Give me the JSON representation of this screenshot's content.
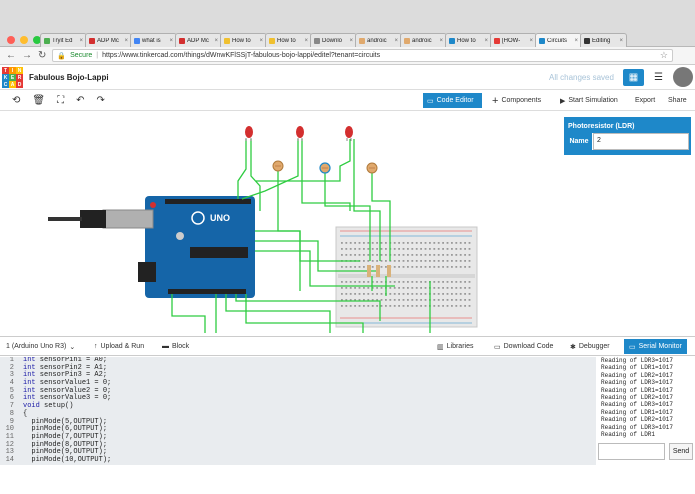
{
  "browser": {
    "tabs": [
      {
        "label": "Tryit Ed",
        "color": "#4caf50"
      },
      {
        "label": "ADP Mc",
        "color": "#d32f2f"
      },
      {
        "label": "what is",
        "color": "#4285f4"
      },
      {
        "label": "ADP Mc",
        "color": "#d32f2f"
      },
      {
        "label": "How to",
        "color": "#f0c02f"
      },
      {
        "label": "How to",
        "color": "#f0c02f"
      },
      {
        "label": "Downlo",
        "color": "#888888"
      },
      {
        "label": "androic",
        "color": "#e0a96d"
      },
      {
        "label": "androic",
        "color": "#e0a96d"
      },
      {
        "label": "How to",
        "color": "#1e88c9"
      },
      {
        "label": "[HOW-",
        "color": "#e53935"
      },
      {
        "label": "Circuits",
        "color": "#1e88c9",
        "active": true
      },
      {
        "label": "Editing",
        "color": "#333333"
      }
    ],
    "secure_label": "Secure",
    "url": "https://www.tinkercad.com/things/dWnwKFlSSjT-fabulous-bojo-lappi/editel?tenant=circuits"
  },
  "header": {
    "logo_letters": [
      "T",
      "I",
      "N",
      "K",
      "E",
      "R",
      "C",
      "A",
      "D"
    ],
    "logo_colors": [
      "#e53935",
      "#ff9800",
      "#ffc107",
      "#1e88c9",
      "#4caf50",
      "#e53935",
      "#1e88c9",
      "#ffc107",
      "#e53935"
    ],
    "project_name": "Fabulous Bojo-Lappi",
    "save_status": "All changes saved"
  },
  "toolbar": {
    "code_editor": "Code Editor",
    "components": "Components",
    "start_simulation": "Start Simulation",
    "export": "Export",
    "share": "Share"
  },
  "inspector": {
    "title": "Photoresistor (LDR)",
    "name_label": "Name",
    "name_value": "2"
  },
  "codebar": {
    "device": "1 (Arduino Uno R3)",
    "upload_run": "Upload & Run",
    "block": "Block",
    "libraries": "Libraries",
    "download_code": "Download Code",
    "debugger": "Debugger",
    "serial_monitor": "Serial Monitor"
  },
  "code": [
    {
      "n": "1",
      "pre": "",
      "kw": "int",
      "rest": " sensorPin1 = A0;"
    },
    {
      "n": "2",
      "pre": "",
      "kw": "int",
      "rest": " sensorPin2 = A1;"
    },
    {
      "n": "3",
      "pre": "",
      "kw": "int",
      "rest": " sensorPin3 = A2;"
    },
    {
      "n": "4",
      "pre": "",
      "kw": "int",
      "rest": " sensorValue1 = 0;"
    },
    {
      "n": "5",
      "pre": "",
      "kw": "int",
      "rest": " sensorValue2 = 0;"
    },
    {
      "n": "6",
      "pre": "",
      "kw": "int",
      "rest": " sensorValue3 = 0;"
    },
    {
      "n": "7",
      "pre": "",
      "kw": "void",
      "rest": " setup()"
    },
    {
      "n": "8",
      "pre": "{",
      "kw": "",
      "rest": ""
    },
    {
      "n": "9",
      "pre": "  pinMode(5,OUTPUT);",
      "kw": "",
      "rest": ""
    },
    {
      "n": "10",
      "pre": "  pinMode(6,OUTPUT);",
      "kw": "",
      "rest": ""
    },
    {
      "n": "11",
      "pre": "  pinMode(7,OUTPUT);",
      "kw": "",
      "rest": ""
    },
    {
      "n": "12",
      "pre": "  pinMode(8,OUTPUT);",
      "kw": "",
      "rest": ""
    },
    {
      "n": "13",
      "pre": "  pinMode(9,OUTPUT);",
      "kw": "",
      "rest": ""
    },
    {
      "n": "14",
      "pre": "  pinMode(10,OUTPUT);",
      "kw": "",
      "rest": ""
    }
  ],
  "serial": [
    "Reading of LDR3=1017",
    "Reading of LDR1=1017",
    "Reading of LDR2=1017",
    "Reading of LDR3=1017",
    "Reading of LDR1=1017",
    "Reading of LDR2=1017",
    "Reading of LDR3=1017",
    "Reading of LDR1=1017",
    "Reading of LDR2=1017",
    "Reading of LDR3=1017",
    "Reading of LDR1"
  ],
  "send_label": "Send",
  "colors": {
    "accent": "#1e88c9",
    "wire": "#2ecc40",
    "board": "#1565a8",
    "led": "#d32f2f"
  }
}
